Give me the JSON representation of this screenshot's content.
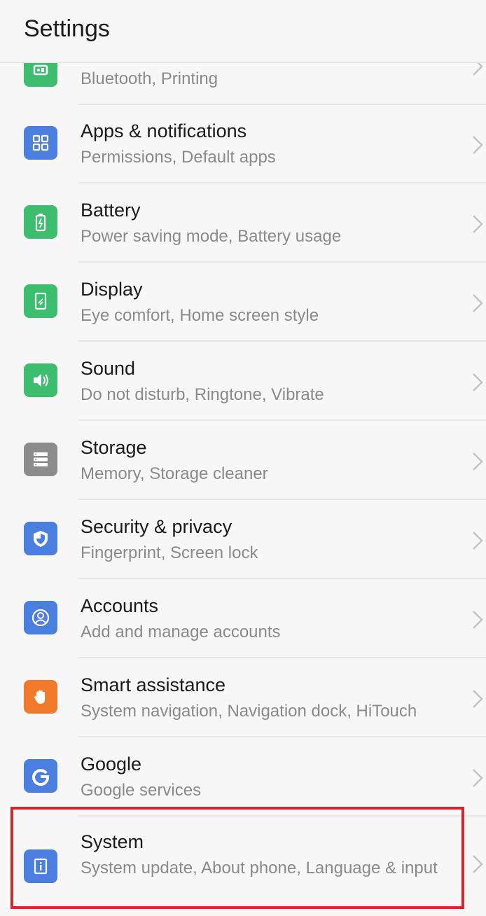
{
  "header": {
    "title": "Settings"
  },
  "items": [
    {
      "label": "",
      "sub": "Bluetooth, Printing",
      "icon": "device-connectivity-icon",
      "color": "#3dbe6e"
    },
    {
      "label": "Apps & notifications",
      "sub": "Permissions, Default apps",
      "icon": "apps-grid-icon",
      "color": "#4a7fe0"
    },
    {
      "label": "Battery",
      "sub": "Power saving mode, Battery usage",
      "icon": "battery-icon",
      "color": "#3dbe6e"
    },
    {
      "label": "Display",
      "sub": "Eye comfort, Home screen style",
      "icon": "display-icon",
      "color": "#3dbe6e"
    },
    {
      "label": "Sound",
      "sub": "Do not disturb, Ringtone, Vibrate",
      "icon": "speaker-icon",
      "color": "#3dbe6e"
    },
    {
      "label": "Storage",
      "sub": "Memory, Storage cleaner",
      "icon": "storage-icon",
      "color": "#8c8c8c"
    },
    {
      "label": "Security & privacy",
      "sub": "Fingerprint, Screen lock",
      "icon": "shield-icon",
      "color": "#4a7fe0"
    },
    {
      "label": "Accounts",
      "sub": "Add and manage accounts",
      "icon": "account-icon",
      "color": "#4a7fe0"
    },
    {
      "label": "Smart assistance",
      "sub": "System navigation, Navigation dock, HiTouch",
      "icon": "hand-icon",
      "color": "#f07a2a"
    },
    {
      "label": "Google",
      "sub": "Google services",
      "icon": "google-g-icon",
      "color": "#4a7fe0"
    },
    {
      "label": "System",
      "sub": "System update, About phone, Language & input",
      "icon": "info-icon",
      "color": "#4a7fe0"
    }
  ],
  "highlight": {
    "target": "System",
    "color": "#d7262e"
  }
}
